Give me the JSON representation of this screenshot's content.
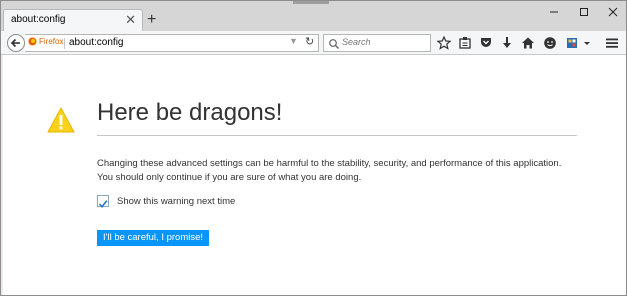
{
  "tab": {
    "title": "about:config",
    "close": "✕",
    "new_tab": "+"
  },
  "window_controls": {
    "minimize": "minimize-icon",
    "maximize": "maximize-icon",
    "close": "close-icon"
  },
  "navbar": {
    "identity_label": "Firefox",
    "url": "about:config",
    "search_placeholder": "Search",
    "icons": [
      "bookmark-star-icon",
      "reading-list-icon",
      "pocket-icon",
      "download-icon",
      "home-icon",
      "emoji-icon",
      "extension-icon",
      "menu-icon"
    ]
  },
  "page": {
    "title": "Here be dragons!",
    "description": "Changing these advanced settings can be harmful to the stability, security, and performance of this application. You should only continue if you are sure of what you are doing.",
    "checkbox_label": "Show this warning next time",
    "checkbox_checked": true,
    "button_label": "I'll be careful, I promise!"
  },
  "colors": {
    "accent": "#0996f8",
    "warning": "#fcd11c",
    "identity": "#d66400"
  }
}
